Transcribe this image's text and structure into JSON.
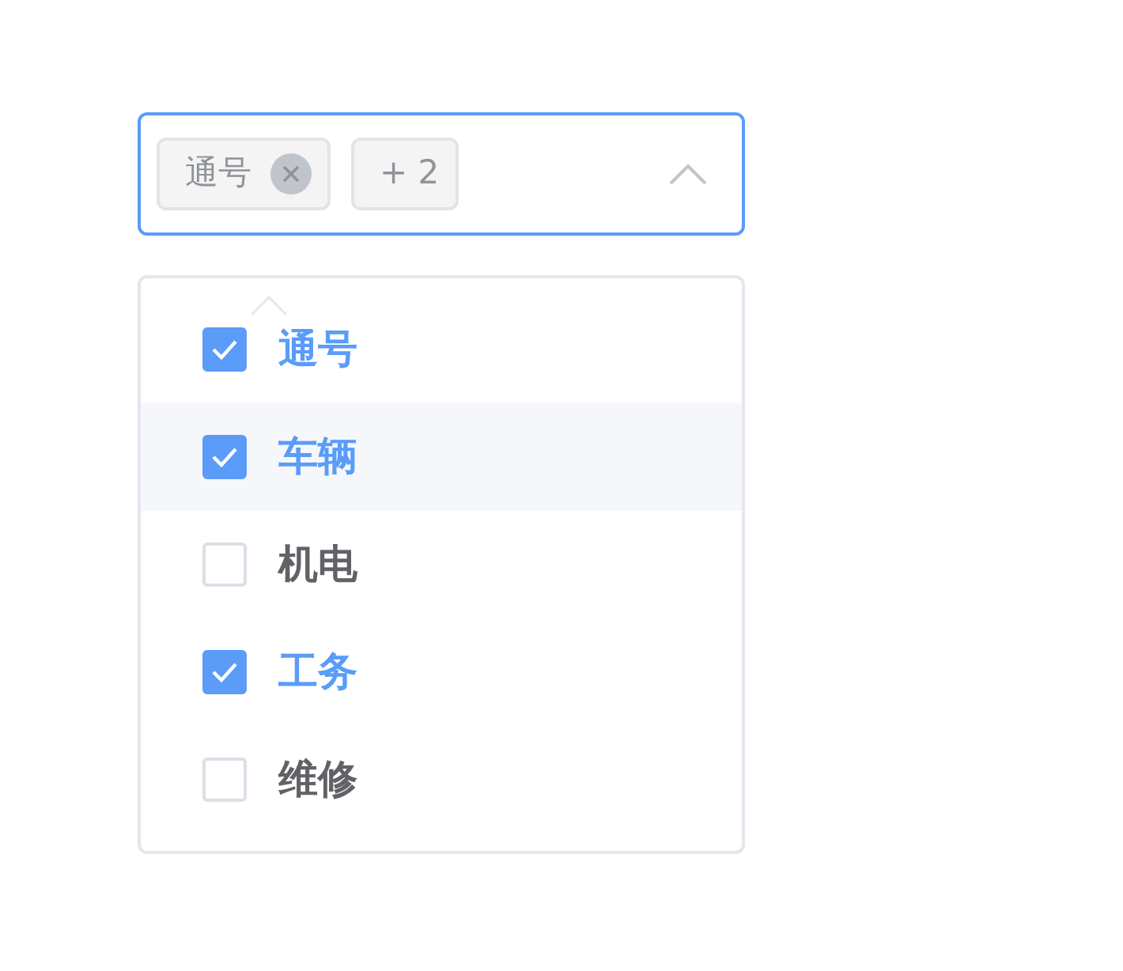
{
  "select": {
    "expanded": true,
    "tags": [
      {
        "label": "通号",
        "closable": true
      },
      {
        "label": "+ 2",
        "closable": false
      }
    ]
  },
  "options": [
    {
      "label": "通号",
      "checked": true,
      "hovered": false
    },
    {
      "label": "车辆",
      "checked": true,
      "hovered": true
    },
    {
      "label": "机电",
      "checked": false,
      "hovered": false
    },
    {
      "label": "工务",
      "checked": true,
      "hovered": false
    },
    {
      "label": "维修",
      "checked": false,
      "hovered": false
    }
  ]
}
